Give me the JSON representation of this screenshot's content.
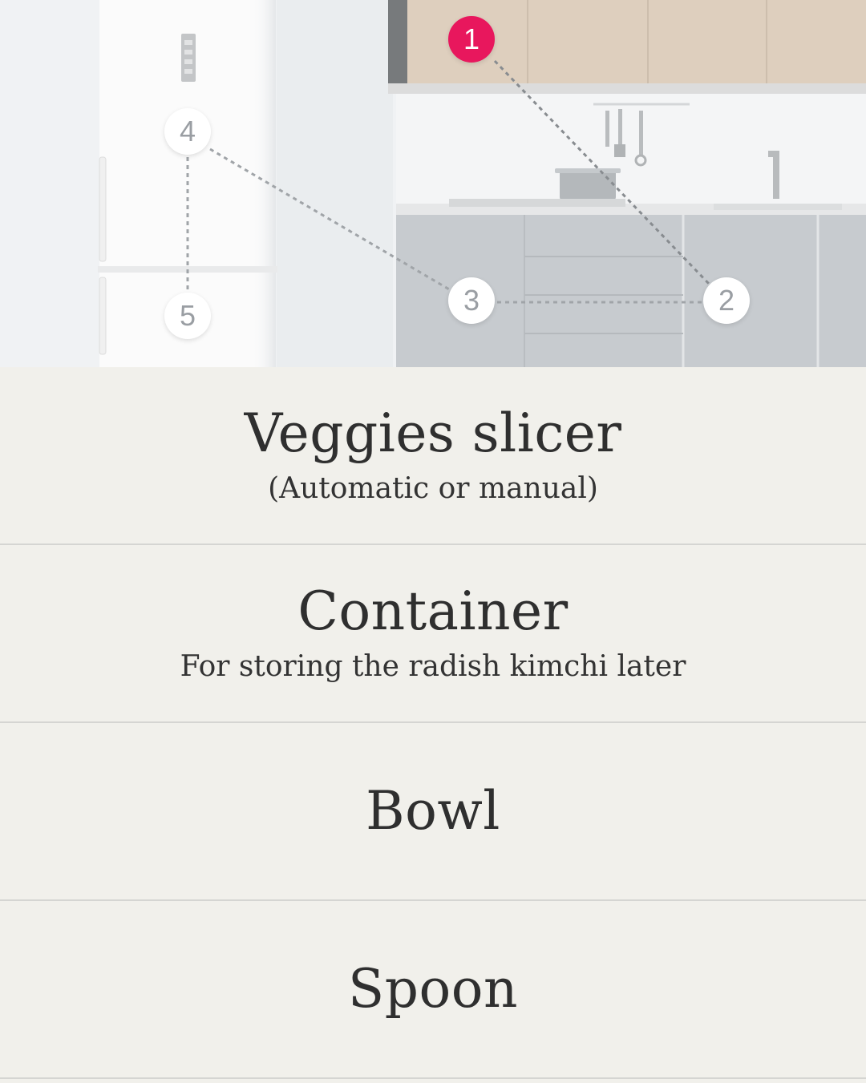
{
  "hotspots": [
    {
      "number": "1",
      "active": true
    },
    {
      "number": "2",
      "active": false
    },
    {
      "number": "3",
      "active": false
    },
    {
      "number": "4",
      "active": false
    },
    {
      "number": "5",
      "active": false
    }
  ],
  "items": [
    {
      "title": "Veggies slicer",
      "subtitle": "(Automatic or manual)"
    },
    {
      "title": "Container",
      "subtitle": "For storing the radish kimchi later"
    },
    {
      "title": "Bowl",
      "subtitle": ""
    },
    {
      "title": "Spoon",
      "subtitle": ""
    }
  ],
  "colors": {
    "active_marker": "#e8175d",
    "background": "#f1f0eb",
    "divider": "#d5d5d2"
  }
}
